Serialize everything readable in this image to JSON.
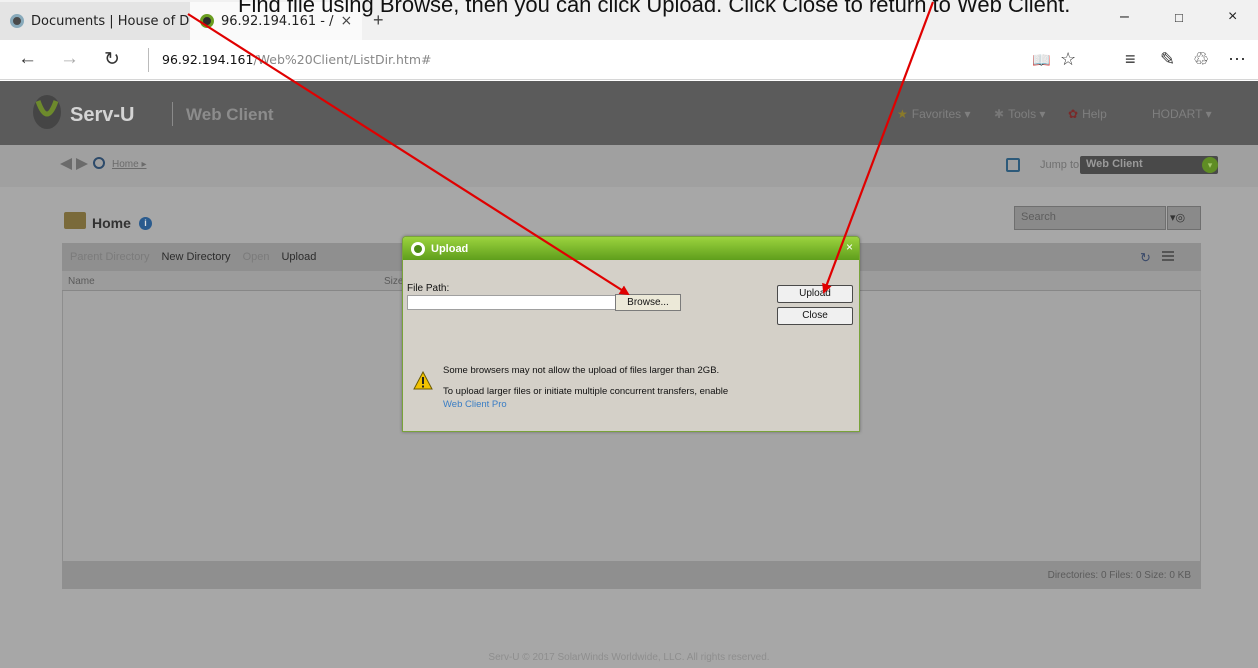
{
  "browser": {
    "tabs": [
      {
        "title": "Documents | House of Dool"
      },
      {
        "title": "96.92.194.161 - /"
      }
    ],
    "tab_close_symbol": "×",
    "new_tab_symbol": "+",
    "window_controls": [
      "–",
      "□",
      "×"
    ],
    "url_host": "96.92.194.161",
    "url_path": "/Web%20Client/ListDir.htm#",
    "nav": {
      "back": "←",
      "forward": "→",
      "refresh": "↻"
    },
    "tools": [
      "📖",
      "☆",
      "≡",
      "✎",
      "♲",
      "⋯"
    ]
  },
  "app": {
    "brand": "Serv-U",
    "subtitle": "Web Client",
    "menu": {
      "favorites": "Favorites ▾",
      "tools": "Tools ▾",
      "help": "Help",
      "user": "HODART ▾"
    },
    "breadcrumb": {
      "home": "Home ▸"
    },
    "jump": {
      "label": "Jump to:",
      "value": "Web Client"
    },
    "folder_title": "Home",
    "search_placeholder": "Search",
    "toolbar": {
      "parent_directory": "Parent Directory",
      "new_directory": "New Directory",
      "open": "Open",
      "upload": "Upload"
    },
    "columns": {
      "name": "Name",
      "size": "Size"
    },
    "status": "Directories: 0   Files: 0   Size: 0 KB",
    "copyright": "Serv-U © 2017 SolarWinds Worldwide, LLC. All rights reserved."
  },
  "dialog": {
    "title": "Upload",
    "file_path_label": "File Path:",
    "browse_label": "Browse...",
    "upload_button": "Upload",
    "close_button": "Close",
    "warning_line1": "Some browsers may not allow the upload of files larger than 2GB.",
    "warning_line2": "To upload larger files or initiate multiple concurrent transfers, enable",
    "warning_link": "Web Client Pro"
  },
  "annotation": {
    "banner_text": "Find file using Browse, then you can click Upload. Click Close to return to Web Client."
  },
  "colors": {
    "arrow": "#e00000",
    "dialog_title_bar": "#7cbf2c",
    "app_background": "#a7a7a7",
    "link": "#3a7dc4"
  }
}
